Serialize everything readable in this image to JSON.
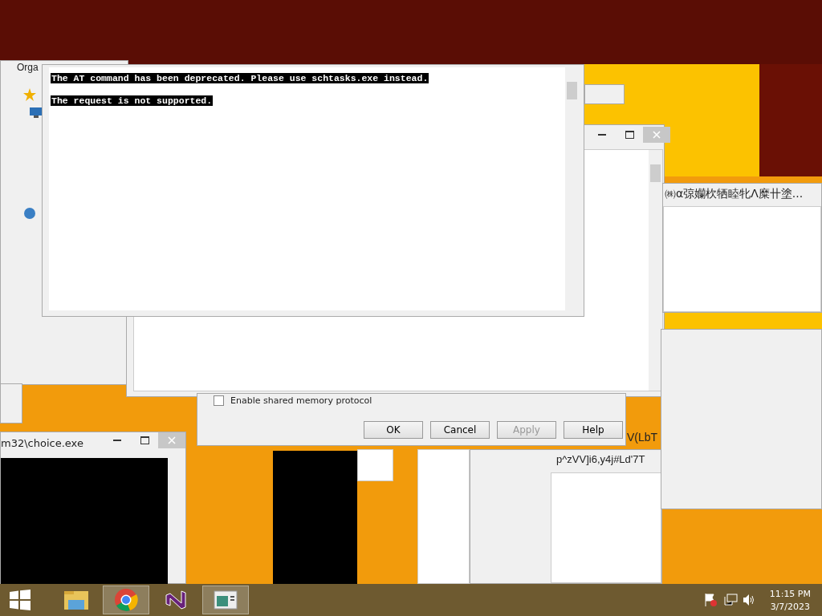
{
  "explorer": {
    "toolbar_label": "Orga"
  },
  "console": {
    "lines": [
      "The AT command has been deprecated. Please use schtasks.exe instead.",
      "The request is not supported."
    ]
  },
  "properties": {
    "checkbox": {
      "label": "Enable shared memory protocol",
      "checked": false
    },
    "buttons": [
      {
        "label": "OK",
        "disabled": false
      },
      {
        "label": "Cancel",
        "disabled": false
      },
      {
        "label": "Apply",
        "disabled": true
      },
      {
        "label": "Help",
        "disabled": false
      }
    ]
  },
  "cjk_window": {
    "text": "㈱α弶孏杴牺睦牝Λ糜卄塗..."
  },
  "garbled_texts": [
    "V(LbT",
    "p^zVV]i6,y4j#Ld'7T"
  ],
  "choice_window": {
    "title": "m32\\choice.exe"
  },
  "taskbar": {
    "apps": [
      {
        "kind": "explorer",
        "selected": false
      },
      {
        "kind": "chrome",
        "selected": true
      },
      {
        "kind": "studio",
        "selected": false
      },
      {
        "kind": "window",
        "selected": true
      }
    ],
    "time": "11:15 PM",
    "date": "3/7/2023"
  }
}
